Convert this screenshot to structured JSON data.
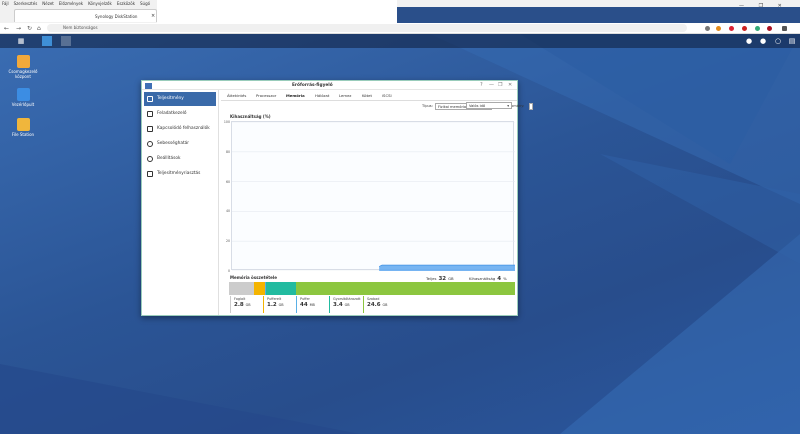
{
  "browser": {
    "menu": [
      "Fájl",
      "Szerkesztés",
      "Nézet",
      "Előzmények",
      "Könyvjelzők",
      "Eszközök",
      "Súgó"
    ],
    "tab_title": "Synology DiskStation",
    "tab_close": "×",
    "url_label": "Nem biztonságos",
    "window_controls": [
      "—",
      "❐",
      "✕"
    ],
    "nav": {
      "back": "←",
      "forward": "→",
      "reload": "↻",
      "home": "⌂"
    }
  },
  "desktop_icons": [
    {
      "label": "Csomagkezelő központ",
      "color": "#f2a93b"
    },
    {
      "label": "Vezérlőpult",
      "color": "#3c8de3"
    },
    {
      "label": "File Station",
      "color": "#f0b63c"
    }
  ],
  "window": {
    "title": "Erőforrás-figyelő",
    "controls": [
      "?",
      "—",
      "❐",
      "✕"
    ],
    "sidebar": [
      {
        "label": "Teljesítmény",
        "active": true
      },
      {
        "label": "Feladatkezelő",
        "active": false
      },
      {
        "label": "Kapcsolódó felhasználók",
        "active": false
      },
      {
        "label": "Sebességhatár",
        "active": false
      },
      {
        "label": "Beállítások",
        "active": false
      },
      {
        "label": "Teljesítményriasztás",
        "active": false
      }
    ],
    "tabs": [
      {
        "label": "Áttekintés",
        "active": false
      },
      {
        "label": "Processzor",
        "active": false
      },
      {
        "label": "Memória",
        "active": true
      },
      {
        "label": "Hálózat",
        "active": false
      },
      {
        "label": "Lemez",
        "active": false
      },
      {
        "label": "Kötet",
        "active": false
      },
      {
        "label": "iSCSI",
        "active": false
      }
    ],
    "view_label": "Típus:",
    "view_value": "Fizikai memória",
    "time_label": "Időtartomány:",
    "time_value": "Valós idő",
    "caret": "▾"
  },
  "chart_data": {
    "type": "area",
    "title": "Kihasználtság (%)",
    "ylim": [
      0,
      100
    ],
    "yticks": [
      0,
      20,
      40,
      60,
      80,
      100
    ],
    "grid": true,
    "x": [
      0,
      0.5,
      0.52,
      0.53,
      0.54,
      1.0
    ],
    "values": [
      null,
      null,
      3,
      4,
      4,
      4
    ],
    "color": "#5fa8f0"
  },
  "memory": {
    "title": "Memória összetétele",
    "total_label": "Teljes",
    "total_value": "32",
    "total_unit": "GB",
    "usage_label": "Kihasználtság",
    "usage_value": "4",
    "usage_unit": "%",
    "segments": [
      {
        "name": "Foglalt",
        "value": "2.8",
        "unit": "GB",
        "color": "#cccccc"
      },
      {
        "name": "Pufferelt",
        "value": "1.2",
        "unit": "GB",
        "color": "#f4b400"
      },
      {
        "name": "Puffer",
        "value": "44",
        "unit": "MB",
        "color": "#5ab0e6"
      },
      {
        "name": "Gyorsítótárazott",
        "value": "3.4",
        "unit": "GB",
        "color": "#22bba0"
      },
      {
        "name": "Szabad",
        "value": "24.6",
        "unit": "GB",
        "color": "#8cc63f"
      }
    ]
  }
}
